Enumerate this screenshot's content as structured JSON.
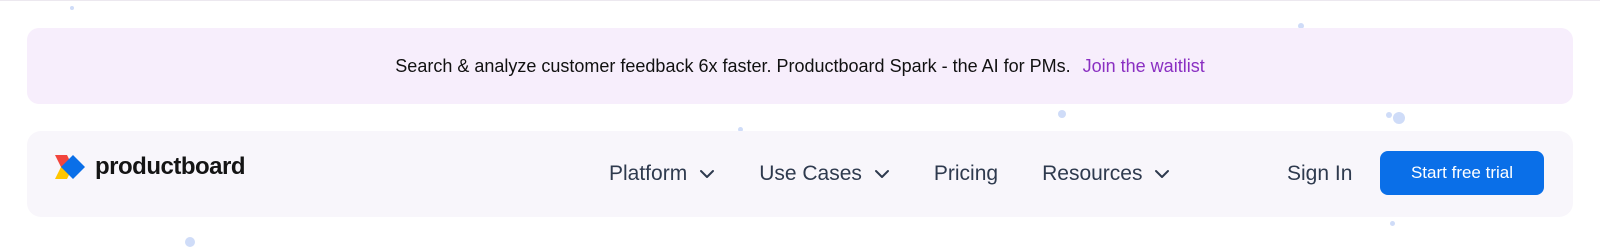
{
  "banner": {
    "text": "Search & analyze customer feedback 6x faster. Productboard Spark - the AI for PMs.",
    "link_label": "Join the waitlist"
  },
  "nav": {
    "logo_text": "productboard",
    "logo_icon": "productboard-logo-icon",
    "items": [
      {
        "label": "Platform",
        "has_dropdown": true
      },
      {
        "label": "Use Cases",
        "has_dropdown": true
      },
      {
        "label": "Pricing",
        "has_dropdown": false
      },
      {
        "label": "Resources",
        "has_dropdown": true
      }
    ],
    "sign_in_label": "Sign In",
    "cta_label": "Start free trial"
  },
  "colors": {
    "banner_bg": "#f7eefc",
    "banner_link": "#8a2fc2",
    "nav_bg": "#f8f6fb",
    "nav_text": "#2e3a4e",
    "cta_bg": "#0a6fe8",
    "logo_red": "#f2453d",
    "logo_yellow": "#ffc600",
    "logo_blue": "#0a6fe8"
  }
}
